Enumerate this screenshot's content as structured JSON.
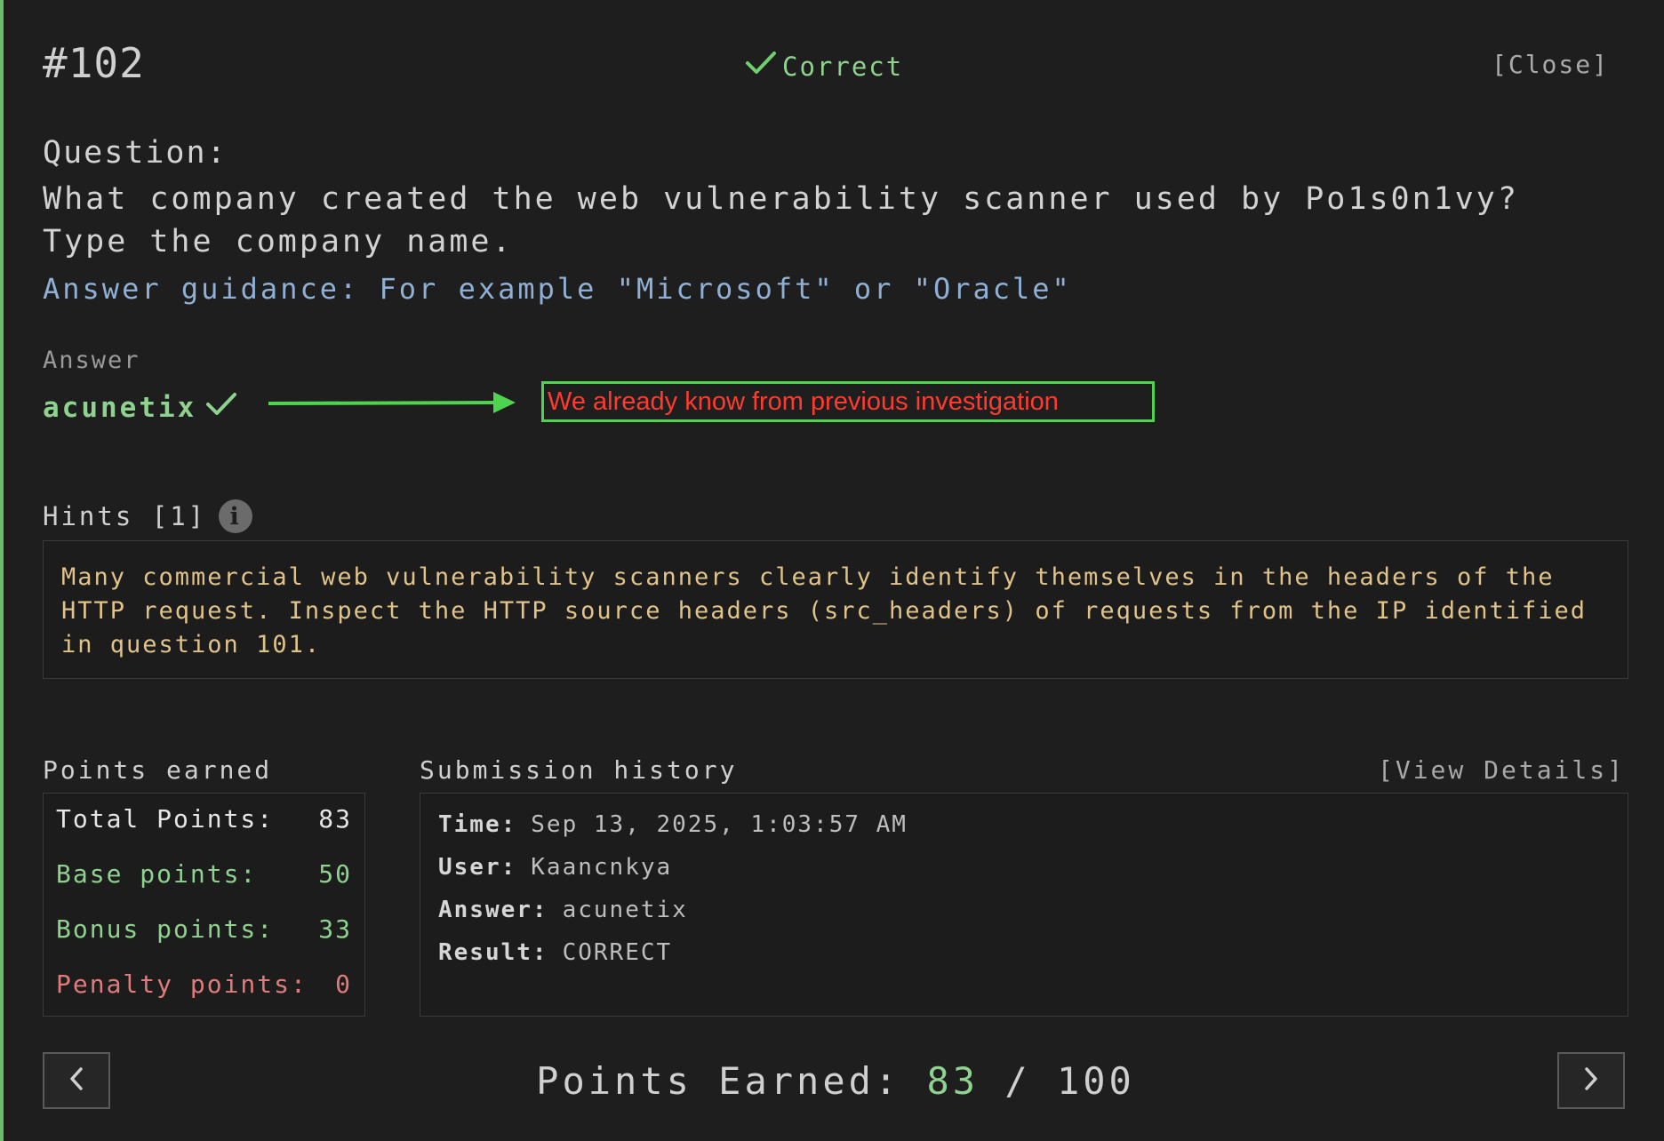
{
  "header": {
    "question_number": "#102",
    "status": "Correct",
    "close_label": "[Close]"
  },
  "question": {
    "label": "Question:",
    "text": "What company created the web vulnerability scanner used by Po1s0n1vy? Type the company name.",
    "guidance": "Answer guidance: For example \"Microsoft\" or \"Oracle\""
  },
  "answer": {
    "label": "Answer",
    "value": "acunetix"
  },
  "annotation": {
    "text": "We already know from previous investigation",
    "border_color": "#4ed44e",
    "text_color": "#ff3b2f"
  },
  "hints": {
    "label": "Hints [1]",
    "text": "Many commercial web vulnerability scanners clearly identify themselves in the headers of the HTTP request. Inspect the HTTP source headers (src_headers) of requests from the IP identified in question 101."
  },
  "points": {
    "label": "Points earned",
    "total_label": "Total Points:",
    "total": "83",
    "base_label": "Base points:",
    "base": "50",
    "bonus_label": "Bonus points:",
    "bonus": "33",
    "penalty_label": "Penalty points:",
    "penalty": "0"
  },
  "submission": {
    "label": "Submission history",
    "view_details": "[View Details]",
    "time_label": "Time:",
    "time": "Sep 13, 2025, 1:03:57 AM",
    "user_label": "User:",
    "user": "Kaancnkya",
    "answer_label": "Answer:",
    "answer": "acunetix",
    "result_label": "Result:",
    "result": "CORRECT"
  },
  "footer": {
    "label": "Points Earned:",
    "earned": "83",
    "separator": "/",
    "max": "100"
  },
  "colors": {
    "accent_green": "#8fd18f",
    "hint_text": "#e0c38a",
    "penalty_red": "#e07b7b",
    "guidance_blue": "#8fb0d4"
  },
  "icons": [
    "check-icon",
    "info-icon",
    "chevron-left-icon",
    "chevron-right-icon",
    "arrow-right-icon"
  ]
}
